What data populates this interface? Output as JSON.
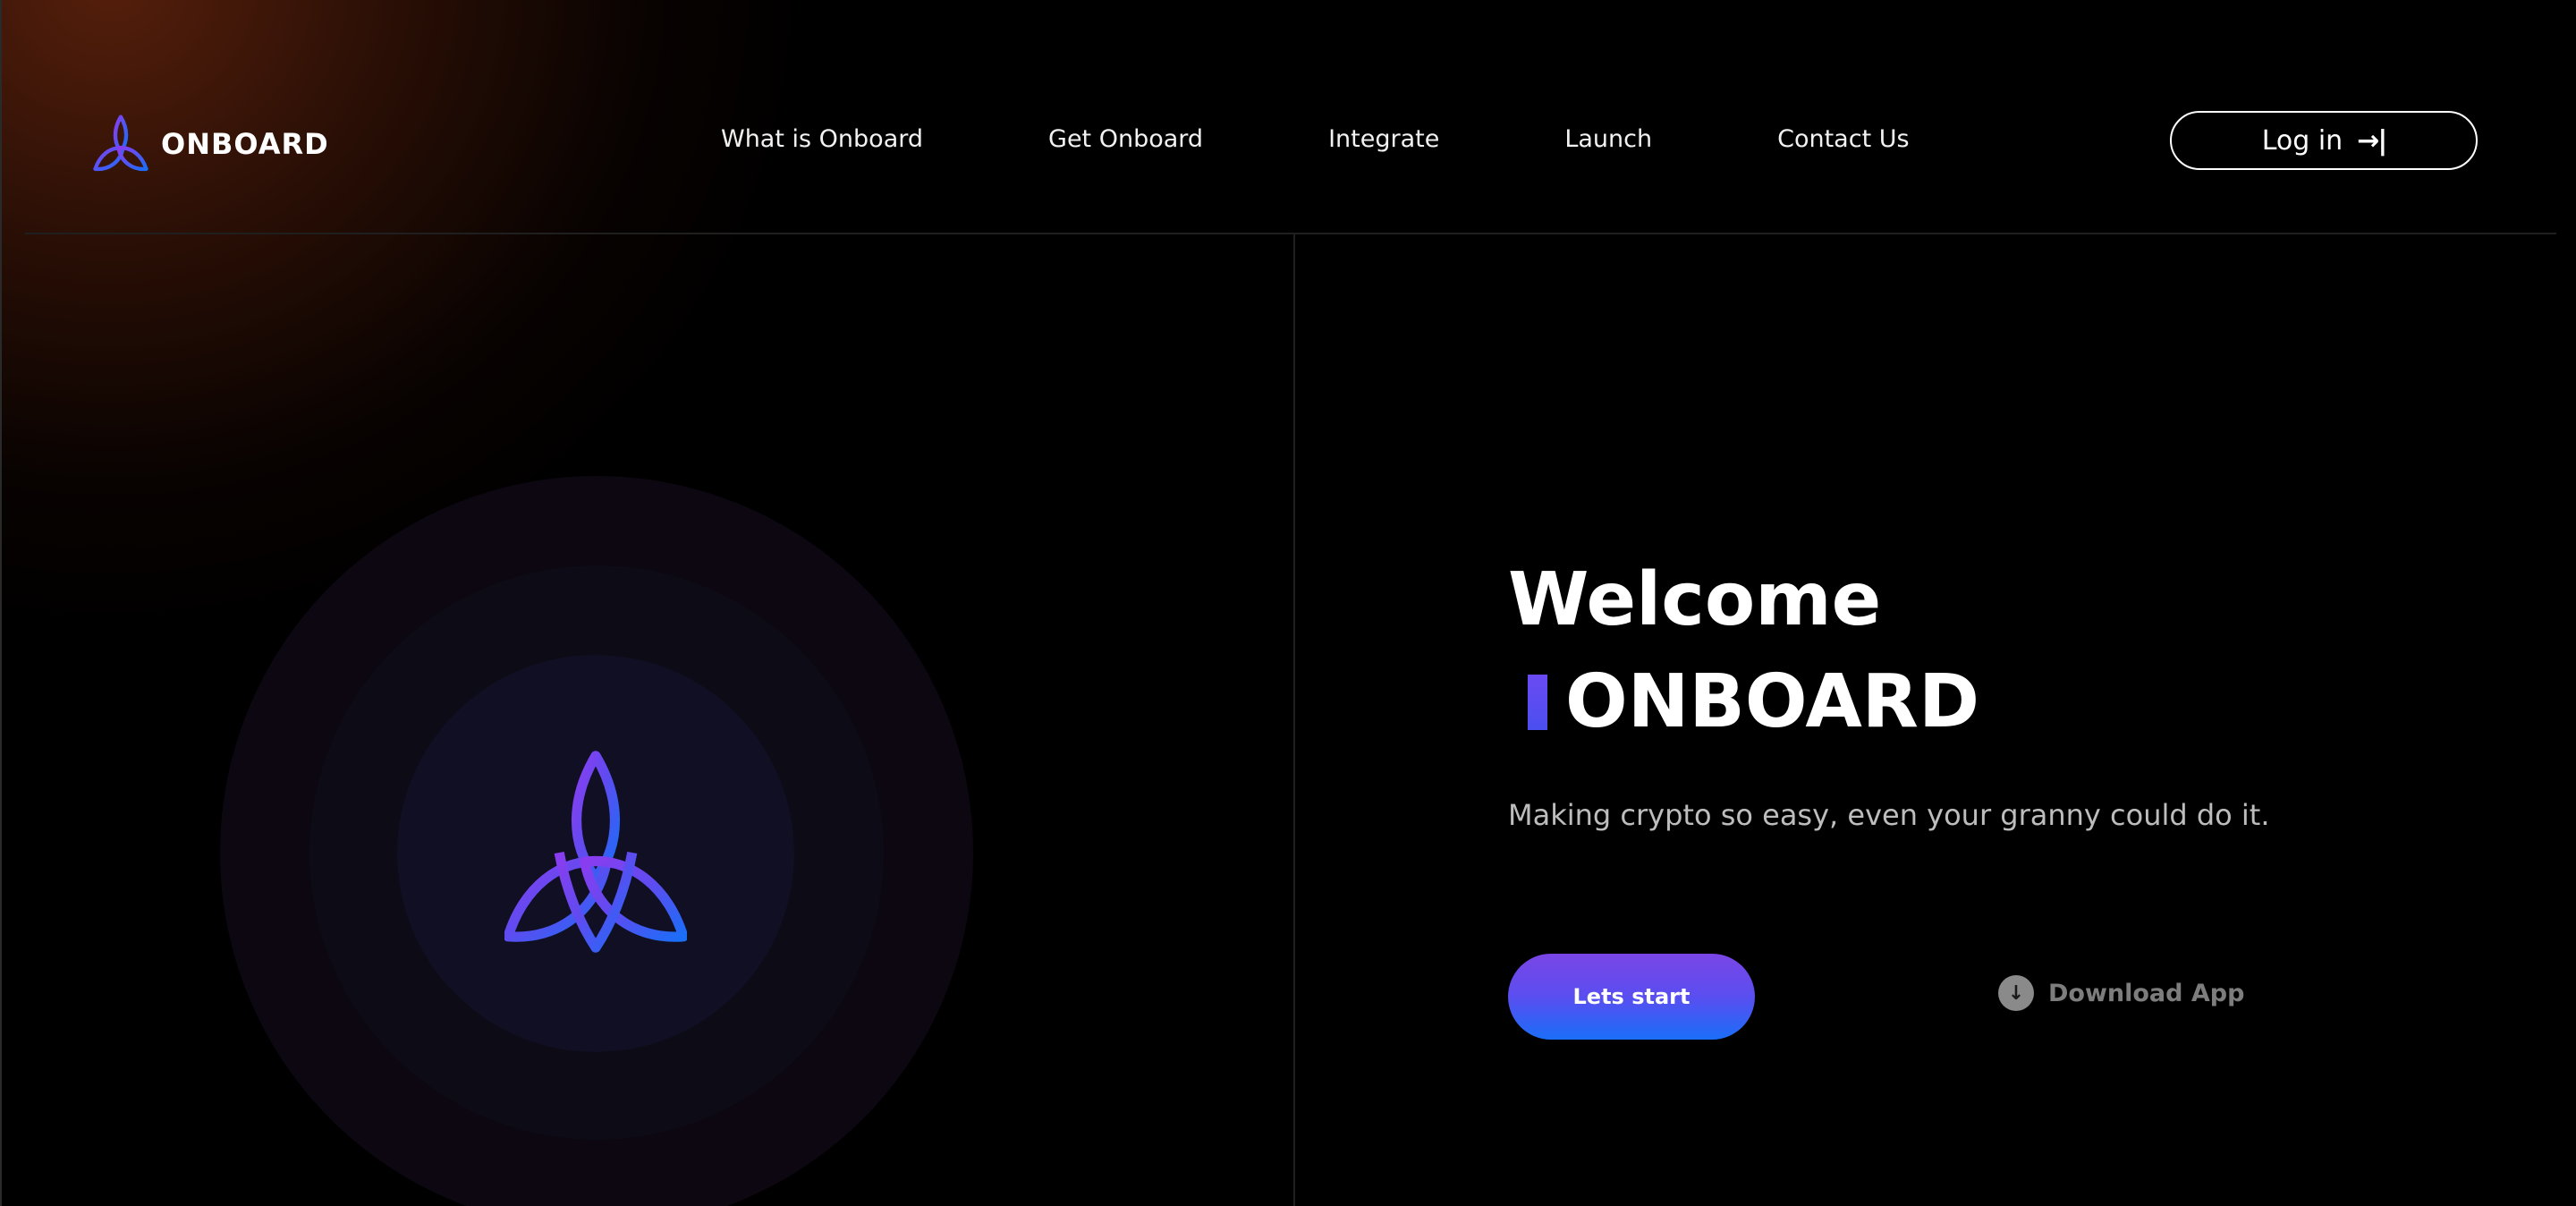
{
  "header": {
    "brand": "ONBOARD",
    "nav": [
      {
        "label": "What is Onboard"
      },
      {
        "label": "Get Onboard"
      },
      {
        "label": "Integrate"
      },
      {
        "label": "Launch"
      },
      {
        "label": "Contact Us"
      }
    ],
    "login_label": "Log in",
    "login_icon": "login-arrow-icon"
  },
  "hero": {
    "welcome": "Welcome",
    "brand_title": "ONBOARD",
    "tagline": "Making crypto so easy, even your granny could do it.",
    "cta_label": "Lets start",
    "download_label": "Download App",
    "download_icon": "download-icon"
  },
  "colors": {
    "background": "#000000",
    "accent_purple": "#7a45e6",
    "accent_blue": "#1a6ef8",
    "glow": "#6e280f"
  }
}
